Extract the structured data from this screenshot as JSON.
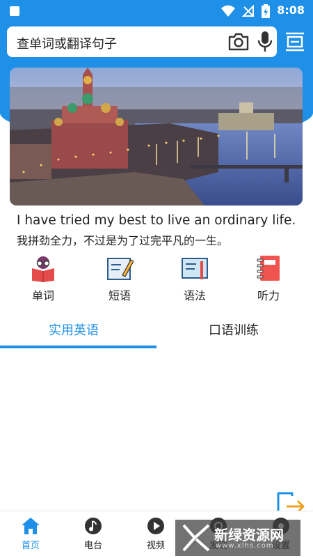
{
  "status_bar": {
    "time": "8:08"
  },
  "search": {
    "placeholder": "查单词或翻译句子"
  },
  "quote": {
    "english": "I have tried my best to live an ordinary life.",
    "chinese": "我拼劲全力，不过是为了过完平凡的一生。"
  },
  "categories": [
    {
      "label": "单词",
      "icon": "book-reader-icon"
    },
    {
      "label": "短语",
      "icon": "pencil-note-icon"
    },
    {
      "label": "语法",
      "icon": "board-pen-icon"
    },
    {
      "label": "听力",
      "icon": "notebook-icon"
    }
  ],
  "tabs": [
    {
      "label": "实用英语",
      "active": true
    },
    {
      "label": "口语训练",
      "active": false
    }
  ],
  "bottom_nav": [
    {
      "label": "首页",
      "icon": "home-icon",
      "active": true
    },
    {
      "label": "电台",
      "icon": "music-note-icon",
      "active": false
    },
    {
      "label": "视频",
      "icon": "play-icon",
      "active": false
    },
    {
      "label": "发现",
      "icon": "discover-icon",
      "active": false
    },
    {
      "label": "设置",
      "icon": "settings-icon",
      "active": false
    }
  ],
  "watermark": {
    "title": "新绿资源网",
    "subtitle": "www.xlhs.com"
  },
  "colors": {
    "accent": "#1e90e8",
    "header": "#1e90e8"
  }
}
